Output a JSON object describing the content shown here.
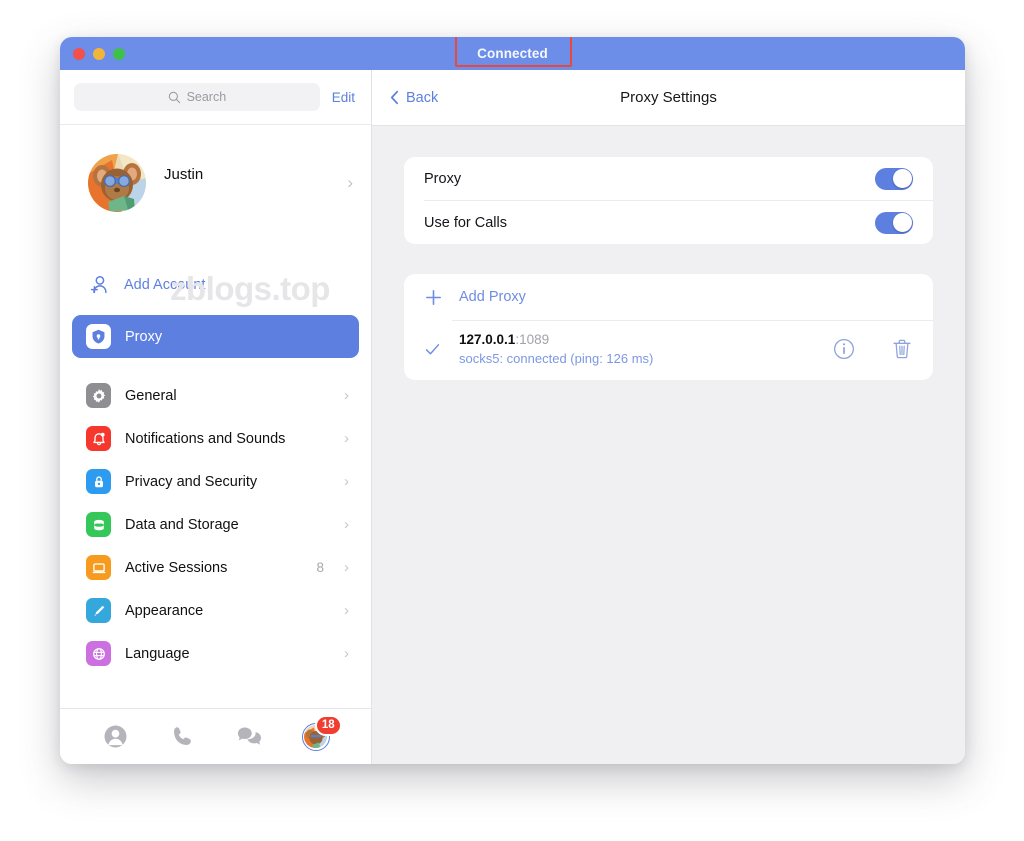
{
  "window": {
    "titlebar": {
      "title": "Connected",
      "accent_color": "#6c8ee8",
      "annotation_color": "#e8493c",
      "traffic_lights": [
        "close-red",
        "minimize-yellow",
        "zoom-green"
      ]
    }
  },
  "sidebar": {
    "search": {
      "placeholder": "Search",
      "icon": "search-icon"
    },
    "edit_label": "Edit",
    "profile": {
      "name": "Justin",
      "avatar": "cartoon-mouse-avatar",
      "chevron": "chevron-right-icon"
    },
    "watermark": "zblogs.top",
    "add_account": {
      "label": "Add Account",
      "icon": "add-person-icon"
    },
    "items": [
      {
        "label": "Proxy",
        "icon": "shield-icon",
        "color": "#ffffff",
        "selected": true,
        "count": "",
        "chevron": false
      },
      {
        "label": "General",
        "icon": "gear-icon",
        "color": "#8e8e93",
        "selected": false,
        "count": "",
        "chevron": true
      },
      {
        "label": "Notifications and Sounds",
        "icon": "bell-icon",
        "color": "#f5372e",
        "selected": false,
        "count": "",
        "chevron": true
      },
      {
        "label": "Privacy and Security",
        "icon": "lock-icon",
        "color": "#2d9bf0",
        "selected": false,
        "count": "",
        "chevron": true
      },
      {
        "label": "Data and Storage",
        "icon": "database-icon",
        "color": "#35c759",
        "selected": false,
        "count": "",
        "chevron": true
      },
      {
        "label": "Active Sessions",
        "icon": "laptop-icon",
        "color": "#f79b1e",
        "selected": false,
        "count": "8",
        "chevron": true
      },
      {
        "label": "Appearance",
        "icon": "paintbrush-icon",
        "color": "#34a7dc",
        "selected": false,
        "count": "",
        "chevron": true
      },
      {
        "label": "Language",
        "icon": "globe-icon",
        "color": "#cc6fe0",
        "selected": false,
        "count": "",
        "chevron": true
      }
    ],
    "tabbar": {
      "items": [
        {
          "name": "contacts-tab",
          "icon": "person-circle-icon",
          "selected": false,
          "badge": ""
        },
        {
          "name": "calls-tab",
          "icon": "phone-icon",
          "selected": false,
          "badge": ""
        },
        {
          "name": "chats-tab",
          "icon": "chat-bubbles-icon",
          "selected": false,
          "badge": ""
        },
        {
          "name": "settings-tab",
          "icon": "avatar-icon",
          "selected": true,
          "badge": "18"
        }
      ]
    }
  },
  "content": {
    "back_label": "Back",
    "title": "Proxy Settings",
    "toggles": [
      {
        "label": "Proxy",
        "on": true
      },
      {
        "label": "Use for Calls",
        "on": true
      }
    ],
    "add_proxy": {
      "label": "Add Proxy",
      "icon": "plus-icon"
    },
    "proxy_entry": {
      "checked": true,
      "host": "127.0.0.1",
      "port": ":1089",
      "status": "socks5: connected (ping: 126 ms)",
      "info_icon": "info-circle-icon",
      "delete_icon": "trash-icon"
    }
  }
}
